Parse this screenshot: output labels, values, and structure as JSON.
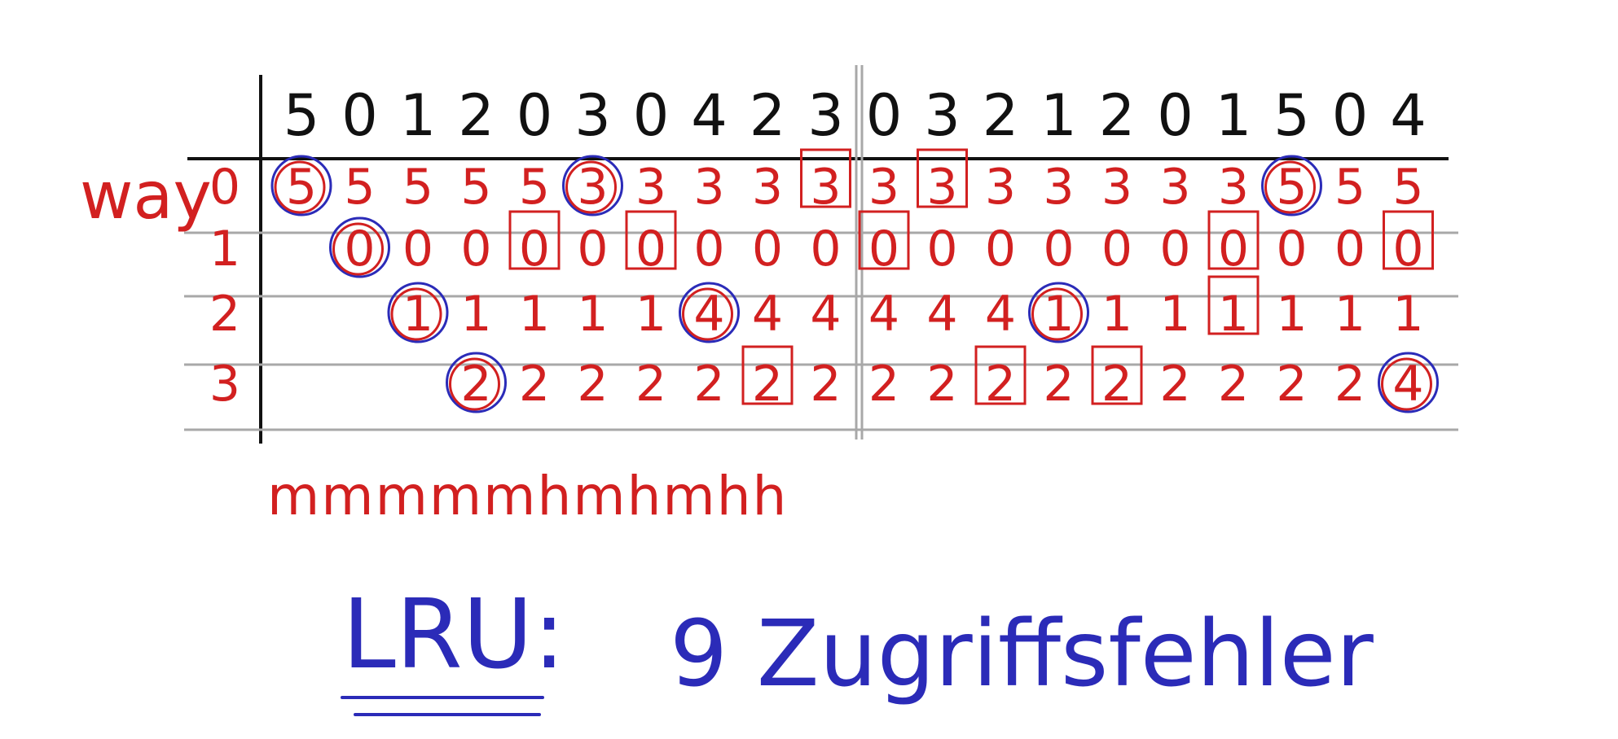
{
  "colors": {
    "ink": "#111111",
    "red": "#d22020",
    "blue": "#2b2bb8",
    "rule": "#a8a8a8"
  },
  "sequence": [
    "5",
    "0",
    "1",
    "2",
    "0",
    "3",
    "0",
    "4",
    "2",
    "3",
    "0",
    "3",
    "2",
    "1",
    "2",
    "0",
    "1",
    "5",
    "0",
    "4"
  ],
  "way_label": "way",
  "row_labels": [
    "0",
    "1",
    "2",
    "3"
  ],
  "rows": [
    [
      "5",
      "5",
      "5",
      "5",
      "5",
      "3",
      "3",
      "3",
      "3",
      "3",
      "3",
      "3",
      "3",
      "3",
      "3",
      "3",
      "3",
      "5",
      "5",
      "5"
    ],
    [
      "",
      "0",
      "0",
      "0",
      "0",
      "0",
      "0",
      "0",
      "0",
      "0",
      "0",
      "0",
      "0",
      "0",
      "0",
      "0",
      "0",
      "0",
      "0",
      "0"
    ],
    [
      "",
      "",
      "1",
      "1",
      "1",
      "1",
      "1",
      "4",
      "4",
      "4",
      "4",
      "4",
      "4",
      "1",
      "1",
      "1",
      "1",
      "1",
      "1",
      "1"
    ],
    [
      "",
      "",
      "",
      "2",
      "2",
      "2",
      "2",
      "2",
      "2",
      "2",
      "2",
      "2",
      "2",
      "2",
      "2",
      "2",
      "2",
      "2",
      "2",
      "4"
    ]
  ],
  "hit_miss": "mmmmmhmhmhh",
  "title": "LRU:",
  "result": "9 Zugriffsfehler"
}
